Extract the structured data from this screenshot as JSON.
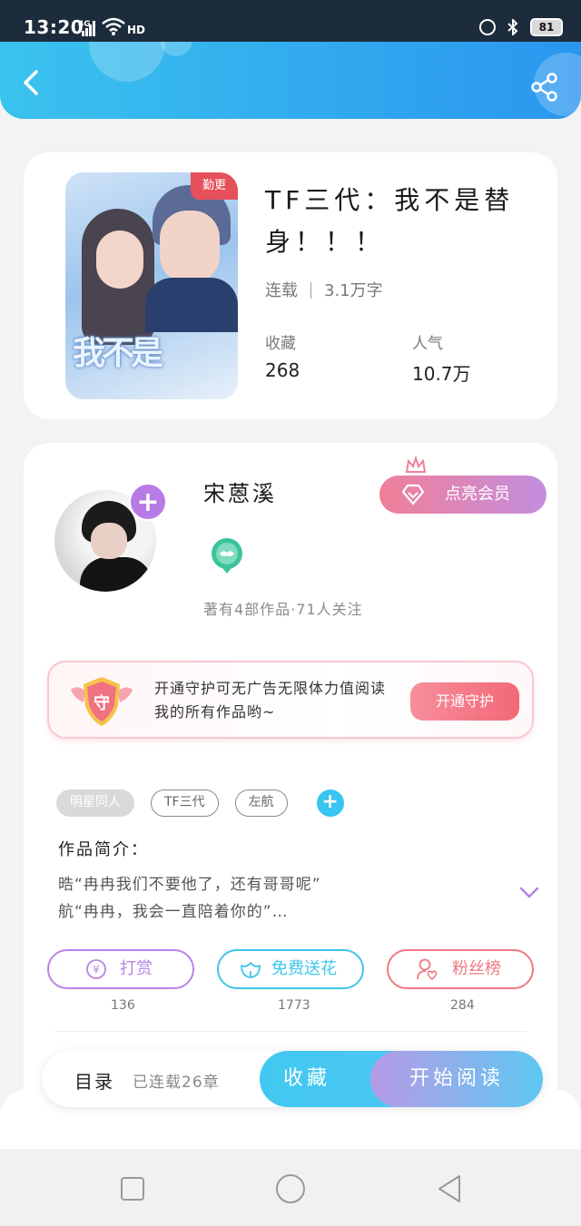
{
  "status_bar": {
    "time": "13:20",
    "network": "4G",
    "hd": "HD",
    "battery": "81"
  },
  "header": {
    "back_icon": "chevron-left-icon",
    "share_icon": "share-icon"
  },
  "book": {
    "badge": "勤更",
    "title": "TF三代：我不是替身！！！",
    "status": "连载",
    "word_count": "3.1万字",
    "favorites_label": "收藏",
    "favorites_value": "268",
    "popularity_label": "人气",
    "popularity_value": "10.7万"
  },
  "author": {
    "name": "宋蒽溪",
    "vip_label": "点亮会员",
    "stats": "著有4部作品·71人关注"
  },
  "guard": {
    "icon_text": "守",
    "text": "开通守护可无广告无限体力值阅读我的所有作品哟~",
    "button": "开通守护"
  },
  "tags": [
    "明星同人",
    "TF三代",
    "左航"
  ],
  "intro": {
    "label": "作品简介：",
    "line1": "晧“冉冉我们不要他了，还有哥哥呢”",
    "line2": "航“冉冉，我会一直陪着你的”…"
  },
  "actions": [
    {
      "label": "打赏",
      "count": "136",
      "color": "#b984e4"
    },
    {
      "label": "免费送花",
      "count": "1773",
      "color": "#3fc6ea"
    },
    {
      "label": "粉丝榜",
      "count": "284",
      "color": "#ef7882"
    }
  ],
  "bottom_bar": {
    "toc": "目录",
    "chapters": "已连载26章",
    "collect": "收藏",
    "read": "开始阅读"
  },
  "colors": {
    "header_start": "#3ac3ee",
    "header_end": "#2a96ef",
    "accent_purple": "#b87be6",
    "accent_blue": "#38c5f0",
    "accent_pink": "#f36877"
  }
}
